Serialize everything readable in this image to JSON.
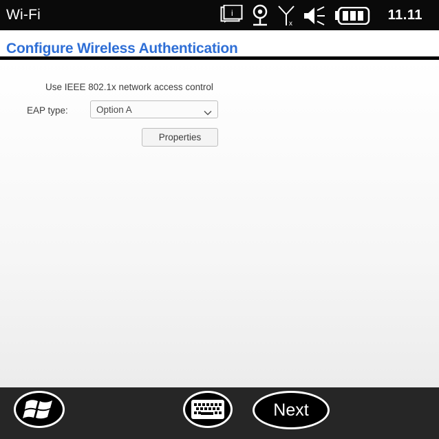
{
  "statusbar": {
    "app_title": "Wi-Fi",
    "time": "11.11",
    "icons": [
      "notification-icon",
      "wireless-network-icon",
      "signal-off-icon",
      "speaker-mute-icon",
      "battery-icon"
    ]
  },
  "header": {
    "title": "Configure Wireless Authentication"
  },
  "form": {
    "ieee_label": "Use IEEE 802.1x network access control",
    "eap_label": "EAP type:",
    "eap_value": "Option A",
    "properties_label": "Properties"
  },
  "bottombar": {
    "next_label": "Next"
  },
  "colors": {
    "title": "#2f6fd6",
    "statusbar_bg": "#0a0a0a",
    "bottombar_bg": "#262626"
  }
}
